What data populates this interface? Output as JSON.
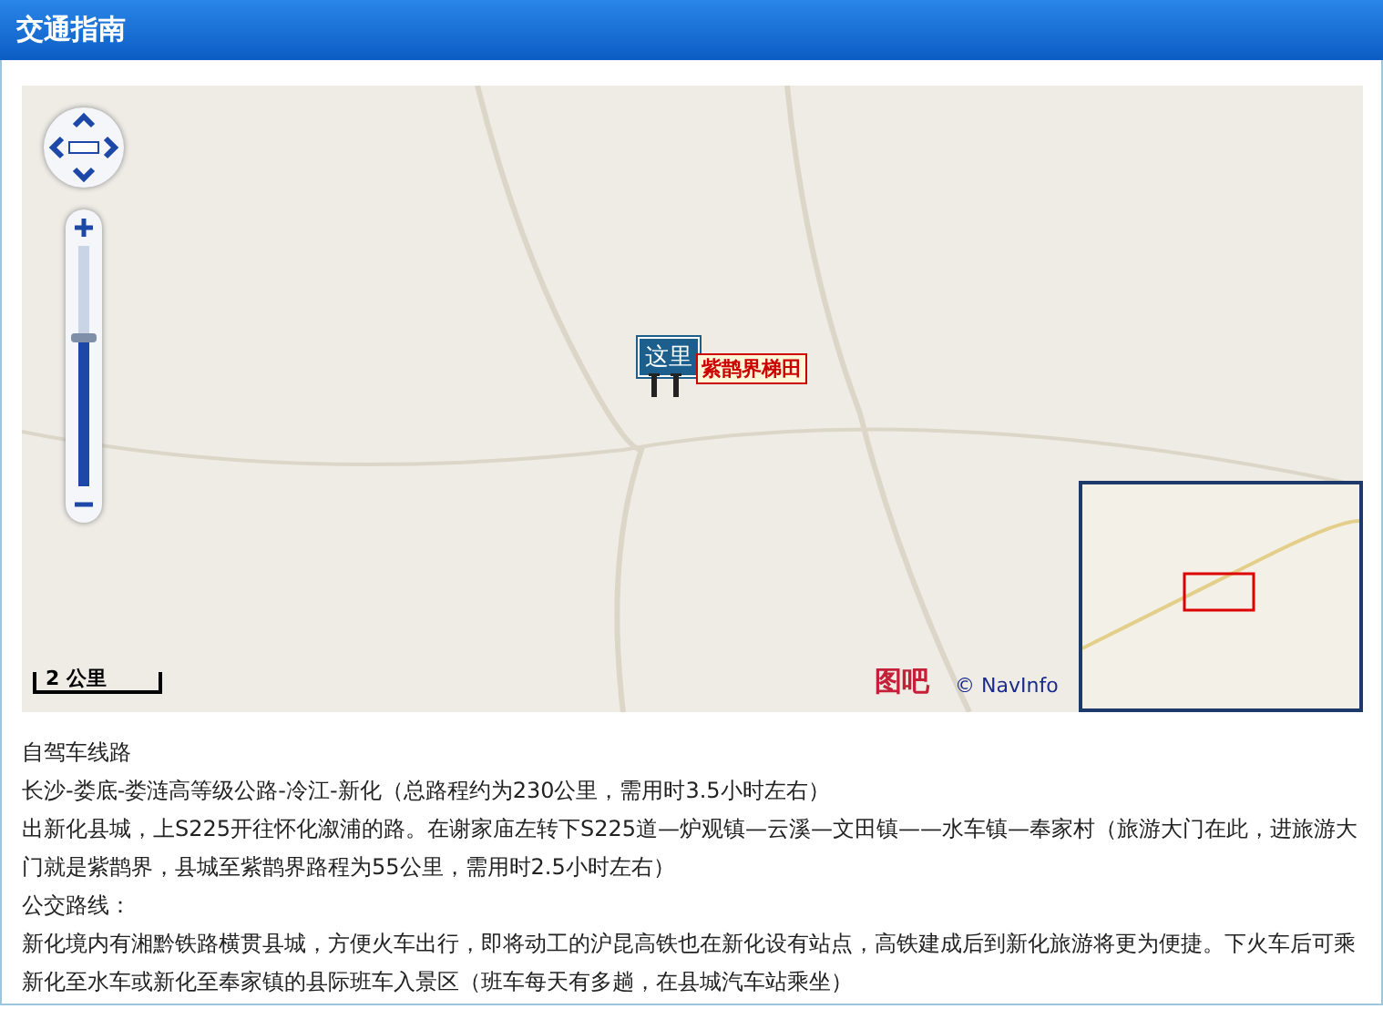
{
  "header": {
    "title": "交通指南"
  },
  "map": {
    "zoom": {
      "level": 0.62
    },
    "marker": {
      "label": "这里"
    },
    "place_label": "紫鹊界梯田",
    "scale": "2 公里",
    "logo": "图吧",
    "copyright": "© NavInfo"
  },
  "paragraphs": [
    "自驾车线路",
    "长沙-娄底-娄涟高等级公路-冷江-新化（总路程约为230公里，需用时3.5小时左右）",
    "出新化县城，上S225开往怀化溆浦的路。在谢家庙左转下S225道—炉观镇—云溪—文田镇——水车镇—奉家村（旅游大门在此，进旅游大门就是紫鹊界，县城至紫鹊界路程为55公里，需用时2.5小时左右）",
    "公交路线：",
    "新化境内有湘黔铁路横贯县城，方便火车出行，即将动工的沪昆高铁也在新化设有站点，高铁建成后到新化旅游将更为便捷。下火车后可乘新化至水车或新化至奉家镇的县际班车入景区（班车每天有多趟，在县城汽车站乘坐）"
  ]
}
